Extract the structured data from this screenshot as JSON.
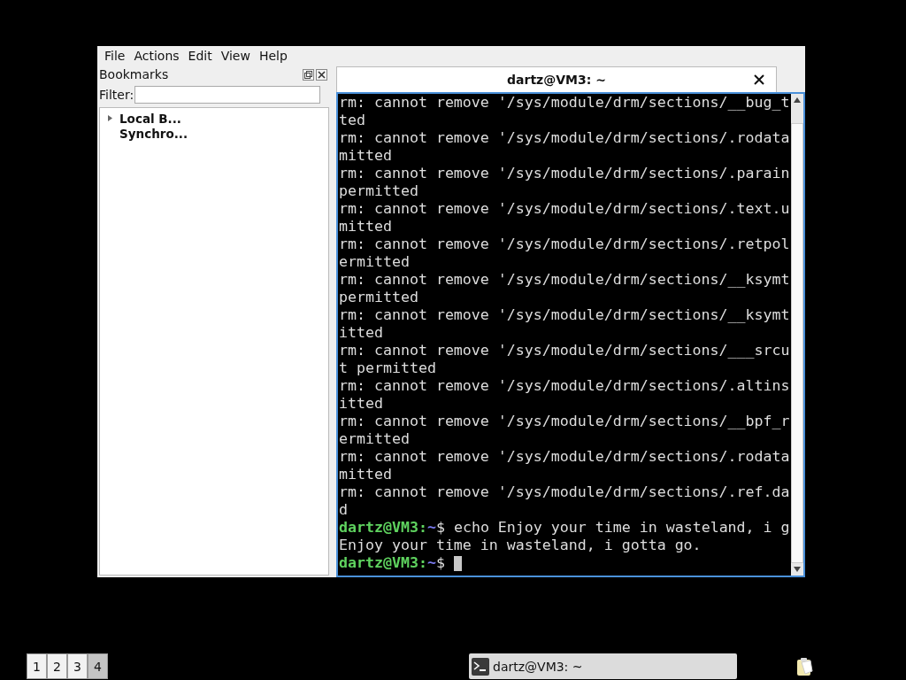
{
  "menu": [
    "File",
    "Actions",
    "Edit",
    "View",
    "Help"
  ],
  "bookmarks": {
    "title": "Bookmarks",
    "filter_label": "Filter:",
    "items": [
      {
        "label": "Local B...",
        "expanded": false
      },
      {
        "label": "Synchro..."
      }
    ]
  },
  "terminal_tab": {
    "title": "dartz@VM3: ~"
  },
  "terminal_lines": [
    {
      "kind": "output",
      "text": "rm: cannot remove '/sys/module/drm/sections/__bug_t"
    },
    {
      "kind": "output",
      "text": "ted"
    },
    {
      "kind": "output",
      "text": "rm: cannot remove '/sys/module/drm/sections/.rodata"
    },
    {
      "kind": "output",
      "text": "mitted"
    },
    {
      "kind": "output",
      "text": "rm: cannot remove '/sys/module/drm/sections/.parain"
    },
    {
      "kind": "output",
      "text": "permitted"
    },
    {
      "kind": "output",
      "text": "rm: cannot remove '/sys/module/drm/sections/.text.u"
    },
    {
      "kind": "output",
      "text": "mitted"
    },
    {
      "kind": "output",
      "text": "rm: cannot remove '/sys/module/drm/sections/.retpol"
    },
    {
      "kind": "output",
      "text": "ermitted"
    },
    {
      "kind": "output",
      "text": "rm: cannot remove '/sys/module/drm/sections/__ksymt"
    },
    {
      "kind": "output",
      "text": "permitted"
    },
    {
      "kind": "output",
      "text": "rm: cannot remove '/sys/module/drm/sections/__ksymt"
    },
    {
      "kind": "output",
      "text": "itted"
    },
    {
      "kind": "output",
      "text": "rm: cannot remove '/sys/module/drm/sections/___srcu"
    },
    {
      "kind": "output",
      "text": "t permitted"
    },
    {
      "kind": "output",
      "text": "rm: cannot remove '/sys/module/drm/sections/.altins"
    },
    {
      "kind": "output",
      "text": "itted"
    },
    {
      "kind": "output",
      "text": "rm: cannot remove '/sys/module/drm/sections/__bpf_r"
    },
    {
      "kind": "output",
      "text": "ermitted"
    },
    {
      "kind": "output",
      "text": "rm: cannot remove '/sys/module/drm/sections/.rodata"
    },
    {
      "kind": "output",
      "text": "mitted"
    },
    {
      "kind": "output",
      "text": "rm: cannot remove '/sys/module/drm/sections/.ref.da"
    },
    {
      "kind": "output",
      "text": "d"
    },
    {
      "kind": "prompt",
      "user": "dartz@VM3",
      "separator": ":",
      "path": "~",
      "symbol": "$",
      "command": "echo Enjoy your time in wasteland, i g"
    },
    {
      "kind": "output",
      "text": "Enjoy your time in wasteland, i gotta go."
    },
    {
      "kind": "prompt",
      "user": "dartz@VM3",
      "separator": ":",
      "path": "~",
      "symbol": "$",
      "cursor": true
    }
  ],
  "taskbar": {
    "workspaces": [
      {
        "label": "1",
        "selected": false
      },
      {
        "label": "2",
        "selected": false
      },
      {
        "label": "3",
        "selected": false
      },
      {
        "label": "4",
        "selected": true
      }
    ],
    "task": {
      "label": "dartz@VM3: ~"
    }
  }
}
